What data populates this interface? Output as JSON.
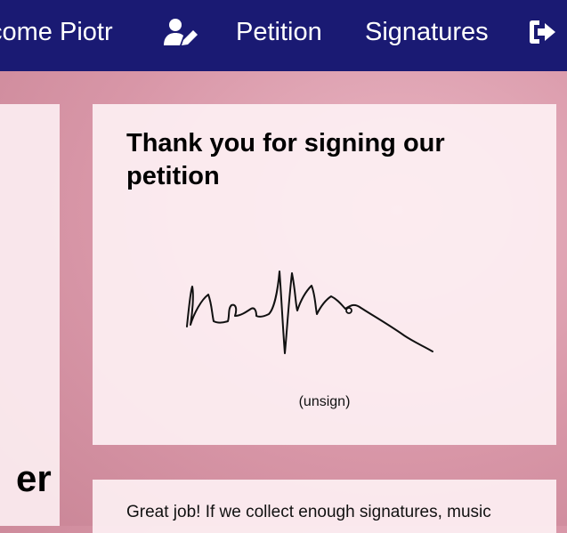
{
  "navbar": {
    "welcome": "come Piotr",
    "profile_icon": "user-edit-icon",
    "petition_label": "Petition",
    "signatures_label": "Signatures",
    "logout_icon": "sign-out-icon",
    "background_color": "#1a1a73"
  },
  "left_card": {
    "fragment_text": "er"
  },
  "main_card": {
    "title": "Thank you for signing our petition",
    "unsign_label": "(unsign)"
  },
  "bottom_card": {
    "text": "Great job! If we collect enough signatures, music"
  }
}
